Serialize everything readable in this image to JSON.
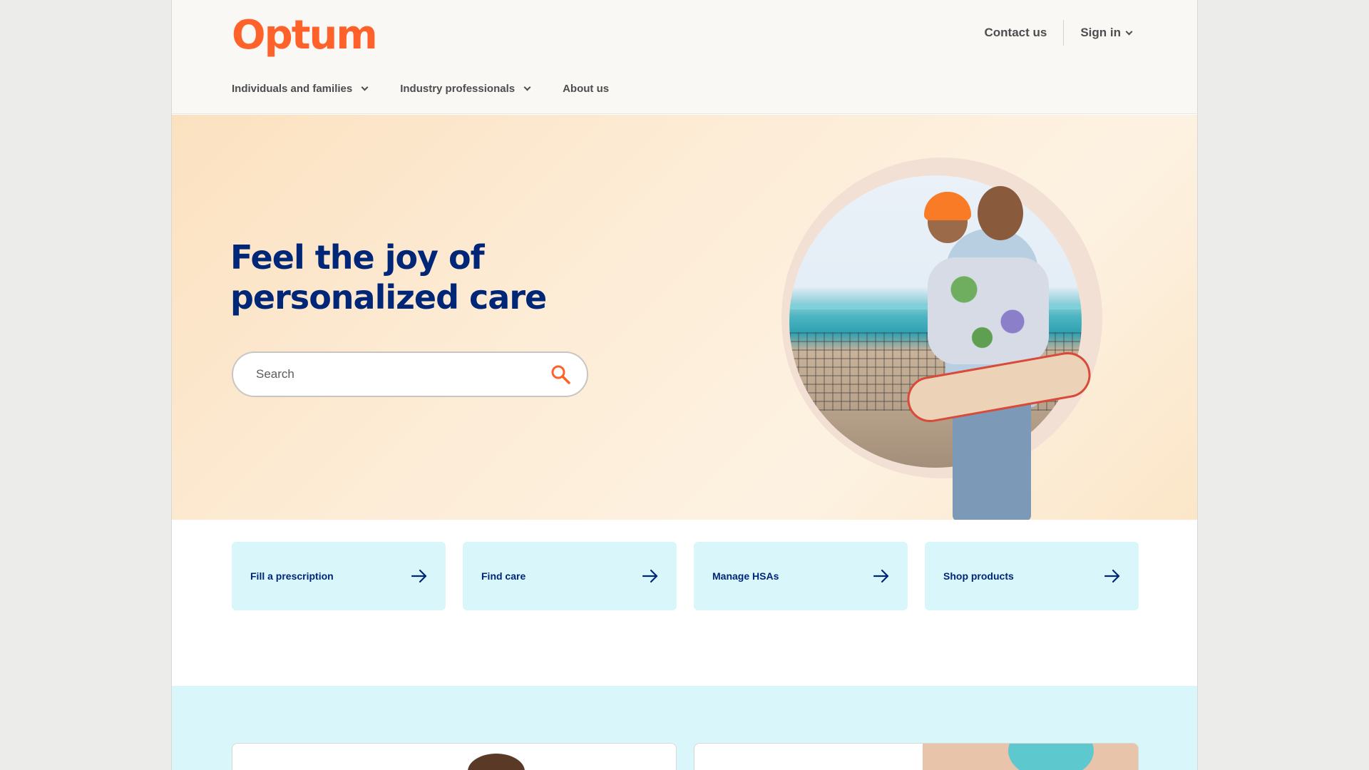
{
  "brand": {
    "logo_text": "Optum",
    "accent": "#ff612b",
    "navy": "#002677"
  },
  "header": {
    "contact_label": "Contact us",
    "signin_label": "Sign in"
  },
  "nav": {
    "items": [
      {
        "label": "Individuals and families",
        "has_dropdown": true
      },
      {
        "label": "Industry professionals",
        "has_dropdown": true
      },
      {
        "label": "About us",
        "has_dropdown": false
      }
    ]
  },
  "hero": {
    "title": "Feel the joy of personalized care",
    "search_placeholder": "Search"
  },
  "quick_links": [
    {
      "label": "Fill a prescription"
    },
    {
      "label": "Find care"
    },
    {
      "label": "Manage HSAs"
    },
    {
      "label": "Shop products"
    }
  ],
  "icons": {
    "search": "search-icon",
    "arrow": "arrow-right-icon",
    "chevron": "chevron-down-icon"
  }
}
